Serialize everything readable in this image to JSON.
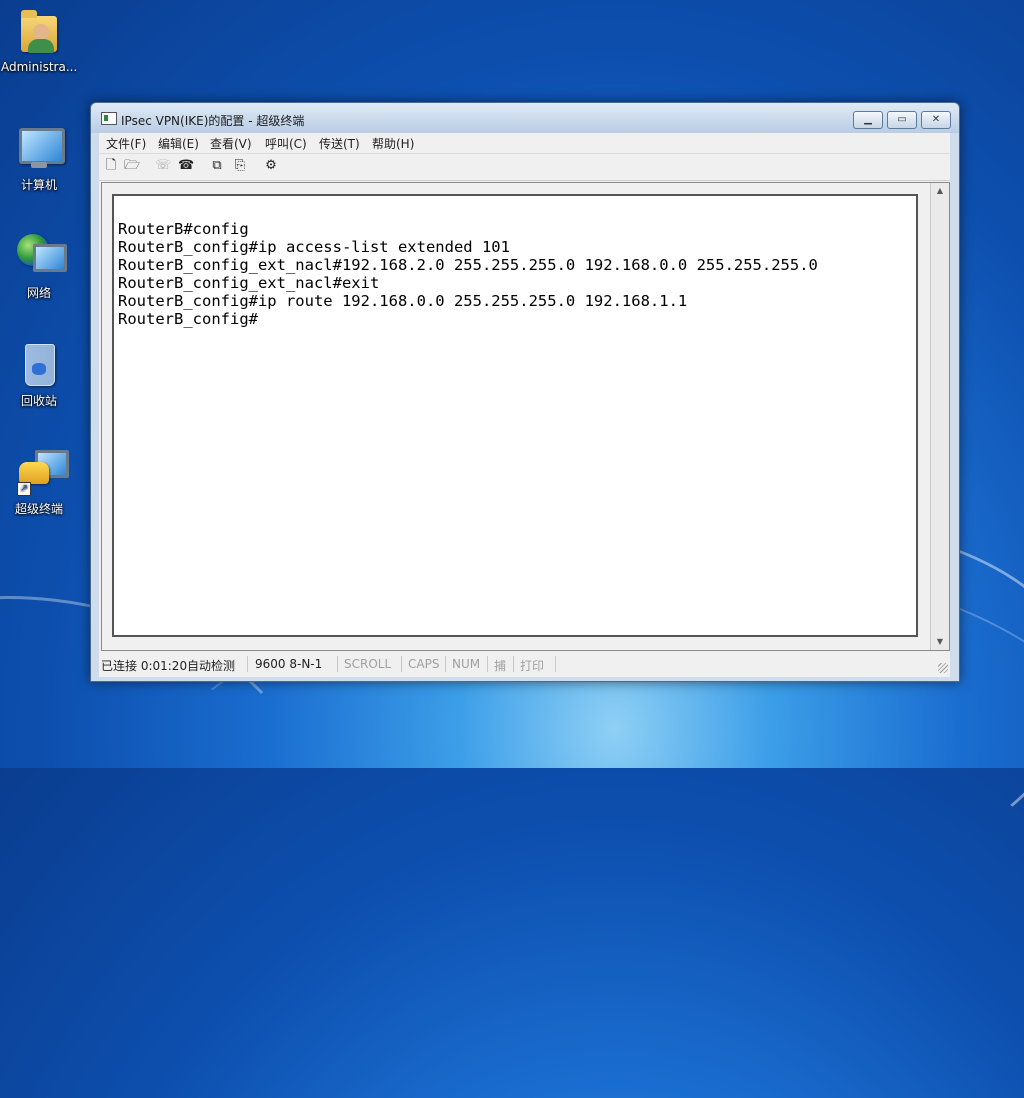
{
  "desktop": {
    "icons": [
      {
        "label": "Administra...",
        "icon": "admin-folder-icon"
      },
      {
        "label": "计算机",
        "icon": "computer-icon"
      },
      {
        "label": "网络",
        "icon": "network-icon"
      },
      {
        "label": "回收站",
        "icon": "recycle-bin-icon"
      },
      {
        "label": "超级终端",
        "icon": "hyperterminal-shortcut-icon"
      }
    ]
  },
  "window": {
    "title": "IPsec VPN(IKE)的配置 - 超级终端",
    "buttons": {
      "minimize": "▁",
      "maximize": "▭",
      "close": "✕"
    },
    "menu": [
      "文件(F)",
      "编辑(E)",
      "查看(V)",
      "呼叫(C)",
      "传送(T)",
      "帮助(H)"
    ],
    "toolbar": [
      {
        "name": "new-icon",
        "glyph": "🗋"
      },
      {
        "name": "open-icon",
        "glyph": "🗁"
      },
      {
        "name": "disconnect-icon",
        "glyph": "☏"
      },
      {
        "name": "dial-icon",
        "glyph": "☎"
      },
      {
        "name": "send-icon",
        "glyph": "⧉"
      },
      {
        "name": "receive-icon",
        "glyph": "⎘"
      },
      {
        "name": "properties-icon",
        "glyph": "⚙"
      }
    ],
    "terminal_text": "RouterB#config\nRouterB_config#ip access-list extended 101\nRouterB_config_ext_nacl#192.168.2.0 255.255.255.0 192.168.0.0 255.255.255.0\nRouterB_config_ext_nacl#exit\nRouterB_config#ip route 192.168.0.0 255.255.255.0 192.168.1.1\nRouterB_config#",
    "status": {
      "connection": "已连接 0:01:20",
      "detect": "自动检测",
      "baud": "9600 8-N-1",
      "scroll": "SCROLL",
      "caps": "CAPS",
      "num": "NUM",
      "capture": "捕",
      "print": "打印"
    }
  }
}
